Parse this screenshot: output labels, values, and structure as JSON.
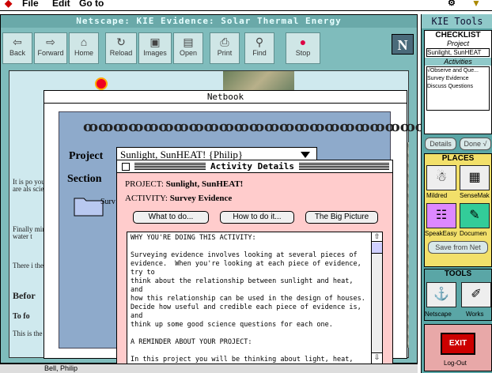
{
  "menubar": {
    "items": [
      "File",
      "Edit",
      "Go to"
    ]
  },
  "netscape": {
    "title": "Netscape: KIE Evidence: Solar Thermal Energy",
    "toolbar": [
      {
        "label": "Back",
        "icon": "back-icon"
      },
      {
        "label": "Forward",
        "icon": "forward-icon"
      },
      {
        "label": "Home",
        "icon": "home-icon"
      },
      {
        "label": "Reload",
        "icon": "reload-icon"
      },
      {
        "label": "Images",
        "icon": "images-icon"
      },
      {
        "label": "Open",
        "icon": "open-icon"
      },
      {
        "label": "Print",
        "icon": "print-icon"
      },
      {
        "label": "Find",
        "icon": "find-icon"
      },
      {
        "label": "Stop",
        "icon": "stop-icon"
      }
    ],
    "logo": "N",
    "page_text": {
      "p1": "It is po your h are als scienti",
      "p2": "Finally mirrors water t",
      "p3": "There i therma",
      "h1": "Befor",
      "h2": "To fo",
      "p4": "This is the pag"
    }
  },
  "netbook": {
    "title": "Netbook",
    "project_label": "Project",
    "project_value": "Sunlight, SunHEAT! {Philip}",
    "section_label": "Section",
    "folder_label": "Surv",
    "status_name": "Bell, Philip"
  },
  "activity_details": {
    "title": "Activity Details",
    "project_prefix": "PROJECT:",
    "project_name": "Sunlight, SunHEAT!",
    "activity_prefix": "ACTIVITY:",
    "activity_name": "Survey Evidence",
    "buttons": [
      "What to do...",
      "How to do it...",
      "The Big Picture"
    ],
    "text": "WHY YOU'RE DOING THIS ACTIVITY:\n\nSurveying evidence involves looking at several pieces of\nevidence.  When you're looking at each piece of evidence, try to\nthink about the relationship between sunlight and heat, and\nhow this relationship can be used in the design of houses.\nDecide how useful and credible each piece of evidence is, and\nthink up some good science questions for each one.\n\nA REMINDER ABOUT YOUR PROJECT:\n\nIn this project you will be thinking about light, heat, and the"
  },
  "kie": {
    "title": "KIE Tools",
    "checklist": "CHECKLIST",
    "project_label": "Project",
    "project_value": "Sunlight, SunHEAT",
    "activities_label": "Activities",
    "activities": [
      "√Observe and Que...",
      "Survey Evidence",
      "Discuss Questions"
    ],
    "details_btn": "Details",
    "done_btn": "Done √",
    "places_label": "PLACES",
    "places": [
      "Mildred",
      "SenseMak",
      "SpeakEasy",
      "Documen"
    ],
    "save_btn": "Save from Net",
    "tools_label": "TOOLS",
    "tools": [
      "Netscape",
      "Works"
    ],
    "exit_label": "EXIT",
    "logout": "Log-Out"
  },
  "colors": {
    "netscape_bg": "#7fbcbc",
    "activity_bg": "#ffcccc",
    "kie_bg": "#5aa6a6",
    "places_bg": "#f2e06a"
  }
}
